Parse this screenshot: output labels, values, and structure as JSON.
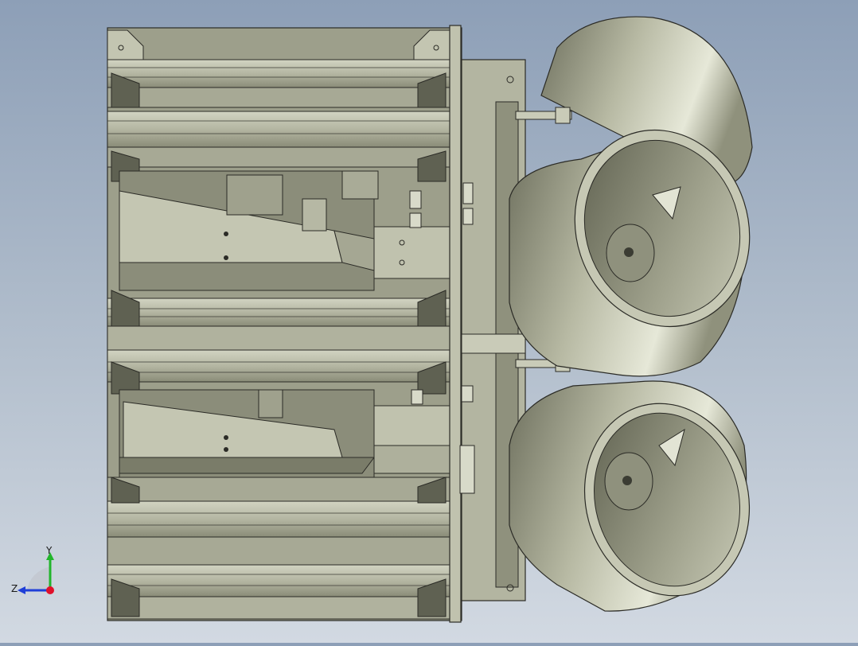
{
  "viewport": {
    "background_top": "#8d9fb7",
    "background_bottom": "#d2d9e2",
    "part_color": "#b9bba9",
    "part_shadow": "#6e705f",
    "edge_color": "#2b2b26"
  },
  "triad": {
    "x_axis_color": "#e0102a",
    "y_axis_color": "#22b52c",
    "z_axis_color": "#1f3fd8",
    "y_label": "Y",
    "z_label": "Z"
  }
}
